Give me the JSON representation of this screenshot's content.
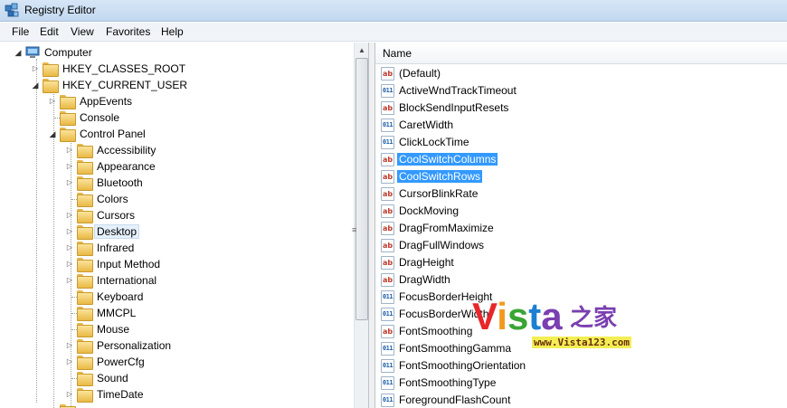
{
  "window": {
    "title": "Registry Editor"
  },
  "menu": [
    "File",
    "Edit",
    "View",
    "Favorites",
    "Help"
  ],
  "tree": {
    "root": "Computer",
    "hkcr": "HKEY_CLASSES_ROOT",
    "hkcu": "HKEY_CURRENT_USER",
    "hkcu_children": [
      "AppEvents",
      "Console",
      "Control Panel"
    ],
    "control_panel_children": [
      "Accessibility",
      "Appearance",
      "Bluetooth",
      "Colors",
      "Cursors",
      "Desktop",
      "Infrared",
      "Input Method",
      "International",
      "Keyboard",
      "MMCPL",
      "Mouse",
      "Personalization",
      "PowerCfg",
      "Sound",
      "TimeDate"
    ],
    "selected": "Desktop"
  },
  "list": {
    "column_name": "Name",
    "values": [
      {
        "name": "(Default)",
        "type": "sz"
      },
      {
        "name": "ActiveWndTrackTimeout",
        "type": "bin"
      },
      {
        "name": "BlockSendInputResets",
        "type": "sz"
      },
      {
        "name": "CaretWidth",
        "type": "bin"
      },
      {
        "name": "ClickLockTime",
        "type": "bin"
      },
      {
        "name": "CoolSwitchColumns",
        "type": "sz",
        "selected": true
      },
      {
        "name": "CoolSwitchRows",
        "type": "sz",
        "selected": true
      },
      {
        "name": "CursorBlinkRate",
        "type": "sz"
      },
      {
        "name": "DockMoving",
        "type": "sz"
      },
      {
        "name": "DragFromMaximize",
        "type": "sz"
      },
      {
        "name": "DragFullWindows",
        "type": "sz"
      },
      {
        "name": "DragHeight",
        "type": "sz"
      },
      {
        "name": "DragWidth",
        "type": "sz"
      },
      {
        "name": "FocusBorderHeight",
        "type": "bin"
      },
      {
        "name": "FocusBorderWidth",
        "type": "bin"
      },
      {
        "name": "FontSmoothing",
        "type": "sz"
      },
      {
        "name": "FontSmoothingGamma",
        "type": "bin"
      },
      {
        "name": "FontSmoothingOrientation",
        "type": "bin"
      },
      {
        "name": "FontSmoothingType",
        "type": "bin"
      },
      {
        "name": "ForegroundFlashCount",
        "type": "bin"
      }
    ]
  },
  "watermark": {
    "brand": "Vista之家",
    "url": "www.Vista123.com"
  },
  "colors": {
    "selection": "#3399ff",
    "titlebar": "#c9dcf0"
  }
}
